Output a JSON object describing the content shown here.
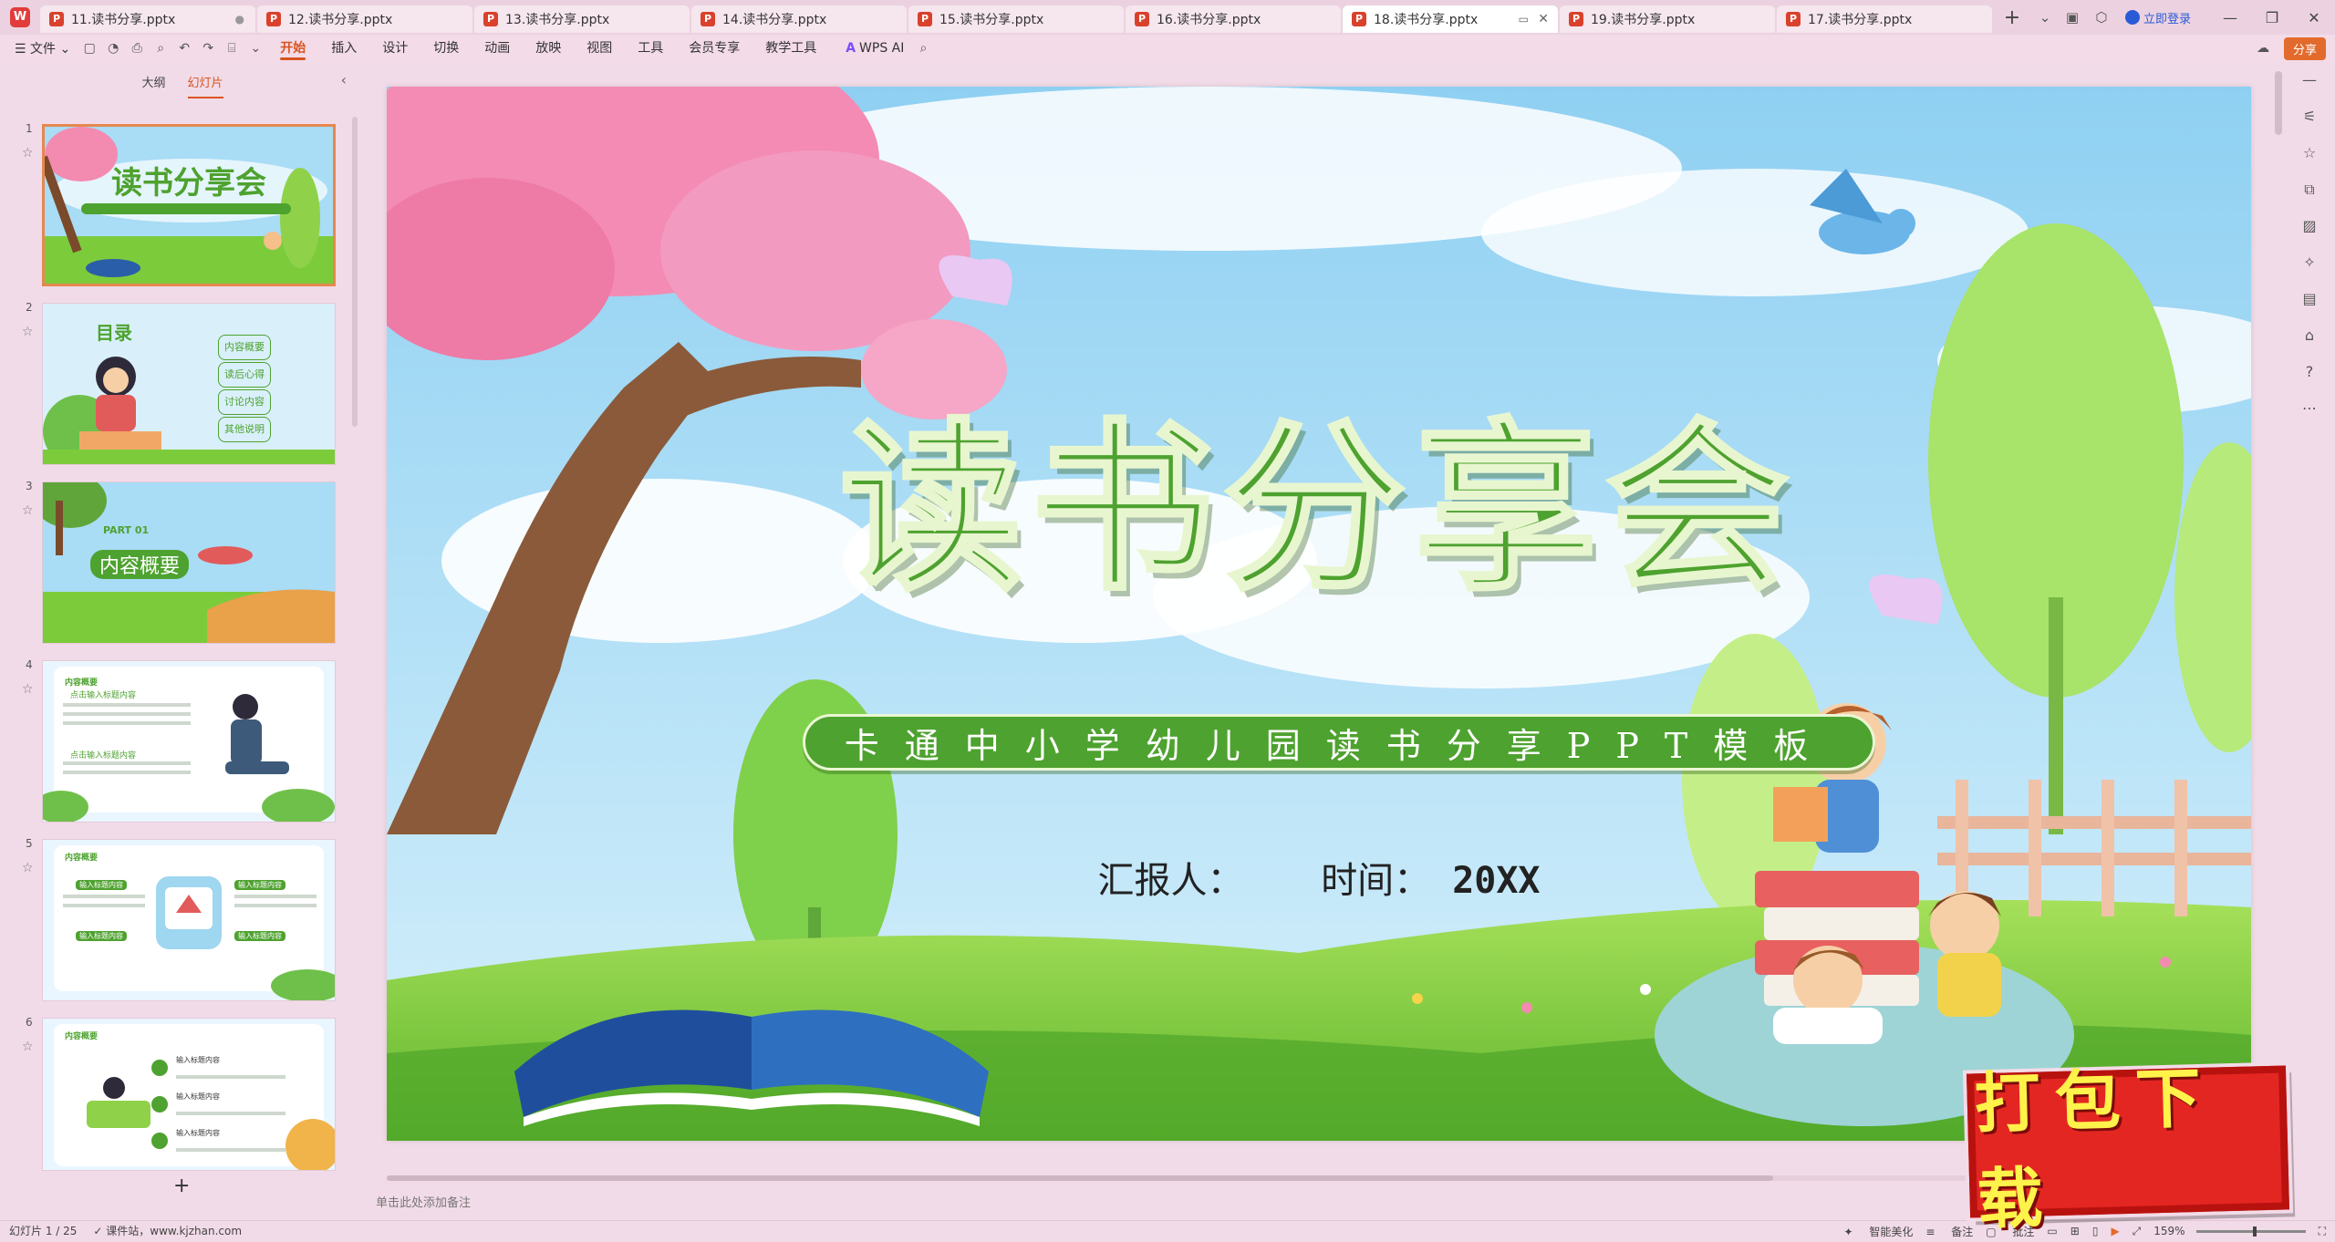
{
  "tabs": [
    {
      "label": "11.读书分享.pptx",
      "active": false
    },
    {
      "label": "12.读书分享.pptx",
      "active": false
    },
    {
      "label": "13.读书分享.pptx",
      "active": false
    },
    {
      "label": "14.读书分享.pptx",
      "active": false
    },
    {
      "label": "15.读书分享.pptx",
      "active": false
    },
    {
      "label": "16.读书分享.pptx",
      "active": false
    },
    {
      "label": "18.读书分享.pptx",
      "active": true
    },
    {
      "label": "19.读书分享.pptx",
      "active": false
    },
    {
      "label": "17.读书分享.pptx",
      "active": false
    }
  ],
  "titlebar": {
    "login_label": "立即登录",
    "add_tab": "+"
  },
  "menubar": {
    "file_label": "文件",
    "ribbon_tabs": [
      "开始",
      "插入",
      "设计",
      "切换",
      "动画",
      "放映",
      "视图",
      "工具",
      "会员专享",
      "教学工具"
    ],
    "active_ribbon": "开始",
    "wps_ai_label": "WPS AI",
    "share_label": "分享"
  },
  "panel": {
    "tabs": [
      "大纲",
      "幻灯片"
    ],
    "active_tab": "幻灯片",
    "thumbnails": [
      {
        "num": "1",
        "title": "读书分享会"
      },
      {
        "num": "2",
        "title": "目录",
        "items": [
          "内容概要",
          "读后心得",
          "讨论内容",
          "其他说明"
        ]
      },
      {
        "num": "3",
        "title": "内容概要",
        "kicker": "PART 01"
      },
      {
        "num": "4",
        "title": "内容概要",
        "items": [
          "点击输入标题内容",
          "点击输入标题内容"
        ]
      },
      {
        "num": "5",
        "title": "内容概要",
        "items": [
          "输入标题内容",
          "输入标题内容",
          "输入标题内容",
          "输入标题内容"
        ]
      },
      {
        "num": "6",
        "title": "内容概要",
        "items": [
          "输入标题内容",
          "输入标题内容",
          "输入标题内容"
        ]
      }
    ],
    "add_label": "+"
  },
  "slide": {
    "title": "读书分享会",
    "subtitle": "卡通中小学幼儿园读书分享PPT模板",
    "reporter_label": "汇报人：",
    "time_label": "时间：",
    "time_value": "20XX"
  },
  "editor": {
    "notes_placeholder": "单击此处添加备注"
  },
  "statusbar": {
    "slide_counter": "幻灯片 1 / 25",
    "source": "课件站，www.kjzhan.com",
    "beautify": "智能美化",
    "notes": "备注",
    "comments": "批注",
    "zoom": "159%"
  },
  "badge": {
    "label": "打包下载"
  },
  "colors": {
    "brand_orange": "#d9541f",
    "title_green": "#4ea22f",
    "badge_red": "#e42622",
    "badge_text": "#fff24a"
  }
}
